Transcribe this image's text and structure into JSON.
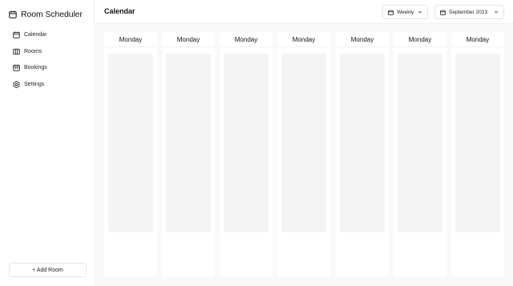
{
  "app": {
    "title": "Room Scheduler",
    "icon": "calendar-icon"
  },
  "sidebar": {
    "items": [
      {
        "label": "Calendar",
        "icon": "calendar-icon"
      },
      {
        "label": "Rooms",
        "icon": "columns-icon"
      },
      {
        "label": "Bookings",
        "icon": "calendar-check-icon"
      },
      {
        "label": "Settings",
        "icon": "gear-icon"
      }
    ],
    "add_button": "+ Add Room"
  },
  "header": {
    "title": "Calendar",
    "view_select": "Weekly",
    "month_select": "September 2023"
  },
  "calendar": {
    "days": [
      "Monday",
      "Monday",
      "Monday",
      "Monday",
      "Monday",
      "Monday",
      "Monday"
    ]
  }
}
